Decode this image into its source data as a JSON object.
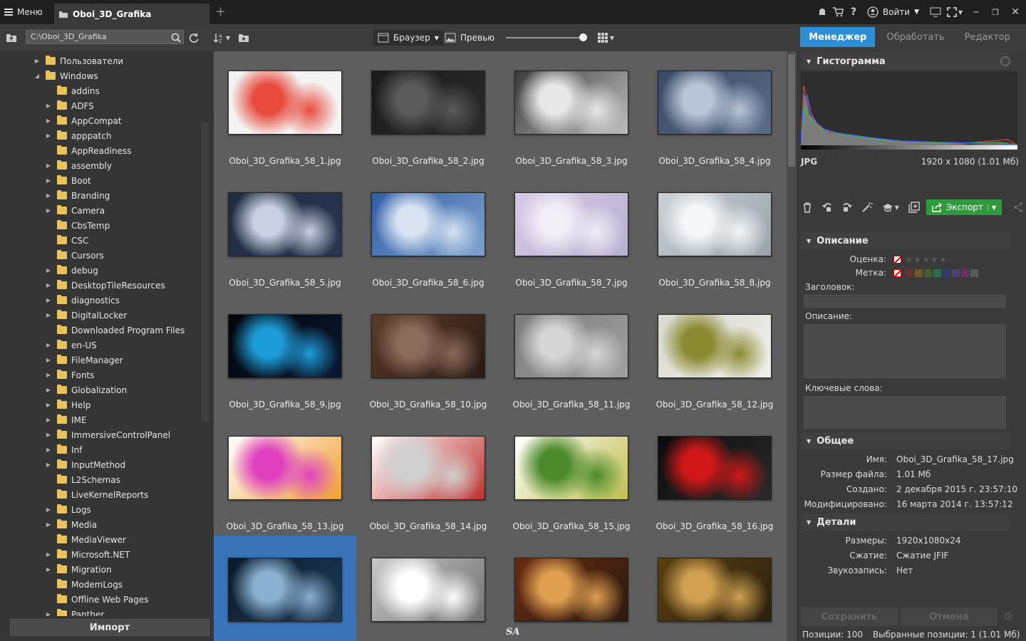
{
  "topbar": {
    "menu_label": "Меню",
    "tab_title": "Oboi_3D_Grafika",
    "signin_label": "Войти"
  },
  "toolbar": {
    "path": "C:\\Oboi_3D_Grafika",
    "view_browser": "Браузер",
    "view_preview": "Превью",
    "zoom_level": 100,
    "modes": [
      "Менеджер",
      "Обработать",
      "Редактор"
    ],
    "active_mode": "Менеджер"
  },
  "tree": {
    "items": [
      {
        "label": "Пользователи",
        "depth": 0,
        "arrow": "collapsed"
      },
      {
        "label": "Windows",
        "depth": 0,
        "arrow": "expanded"
      },
      {
        "label": "addins",
        "depth": 1,
        "arrow": "none"
      },
      {
        "label": "ADFS",
        "depth": 1,
        "arrow": "collapsed"
      },
      {
        "label": "AppCompat",
        "depth": 1,
        "arrow": "collapsed"
      },
      {
        "label": "apppatch",
        "depth": 1,
        "arrow": "collapsed"
      },
      {
        "label": "AppReadiness",
        "depth": 1,
        "arrow": "none"
      },
      {
        "label": "assembly",
        "depth": 1,
        "arrow": "collapsed"
      },
      {
        "label": "Boot",
        "depth": 1,
        "arrow": "collapsed"
      },
      {
        "label": "Branding",
        "depth": 1,
        "arrow": "collapsed"
      },
      {
        "label": "Camera",
        "depth": 1,
        "arrow": "collapsed"
      },
      {
        "label": "CbsTemp",
        "depth": 1,
        "arrow": "none"
      },
      {
        "label": "CSC",
        "depth": 1,
        "arrow": "none"
      },
      {
        "label": "Cursors",
        "depth": 1,
        "arrow": "none"
      },
      {
        "label": "debug",
        "depth": 1,
        "arrow": "collapsed"
      },
      {
        "label": "DesktopTileResources",
        "depth": 1,
        "arrow": "collapsed"
      },
      {
        "label": "diagnostics",
        "depth": 1,
        "arrow": "collapsed"
      },
      {
        "label": "DigitalLocker",
        "depth": 1,
        "arrow": "collapsed"
      },
      {
        "label": "Downloaded Program Files",
        "depth": 1,
        "arrow": "none"
      },
      {
        "label": "en-US",
        "depth": 1,
        "arrow": "collapsed"
      },
      {
        "label": "FileManager",
        "depth": 1,
        "arrow": "collapsed"
      },
      {
        "label": "Fonts",
        "depth": 1,
        "arrow": "collapsed"
      },
      {
        "label": "Globalization",
        "depth": 1,
        "arrow": "collapsed"
      },
      {
        "label": "Help",
        "depth": 1,
        "arrow": "collapsed"
      },
      {
        "label": "IME",
        "depth": 1,
        "arrow": "collapsed"
      },
      {
        "label": "ImmersiveControlPanel",
        "depth": 1,
        "arrow": "collapsed"
      },
      {
        "label": "Inf",
        "depth": 1,
        "arrow": "collapsed"
      },
      {
        "label": "InputMethod",
        "depth": 1,
        "arrow": "collapsed"
      },
      {
        "label": "L2Schemas",
        "depth": 1,
        "arrow": "none"
      },
      {
        "label": "LiveKernelReports",
        "depth": 1,
        "arrow": "none"
      },
      {
        "label": "Logs",
        "depth": 1,
        "arrow": "collapsed"
      },
      {
        "label": "Media",
        "depth": 1,
        "arrow": "collapsed"
      },
      {
        "label": "MediaViewer",
        "depth": 1,
        "arrow": "none"
      },
      {
        "label": "Microsoft.NET",
        "depth": 1,
        "arrow": "collapsed"
      },
      {
        "label": "Migration",
        "depth": 1,
        "arrow": "collapsed"
      },
      {
        "label": "ModemLogs",
        "depth": 1,
        "arrow": "none"
      },
      {
        "label": "Offline Web Pages",
        "depth": 1,
        "arrow": "none"
      },
      {
        "label": "Panther",
        "depth": 1,
        "arrow": "collapsed"
      }
    ],
    "import_label": "Импорт"
  },
  "grid": {
    "selected_index": 16,
    "items": [
      {
        "name": "Oboi_3D_Grafika_58_1.jpg",
        "colors": [
          "#f2f2f2",
          "#e84a3c",
          "#f5f5f5"
        ]
      },
      {
        "name": "Oboi_3D_Grafika_58_2.jpg",
        "colors": [
          "#1a1a1a",
          "#5a5a5a",
          "#2a2a2a"
        ]
      },
      {
        "name": "Oboi_3D_Grafika_58_3.jpg",
        "colors": [
          "#3a3a3a",
          "#e8e8e8",
          "#bdbdbd"
        ]
      },
      {
        "name": "Oboi_3D_Grafika_58_4.jpg",
        "colors": [
          "#3a4a66",
          "#b9c6d8",
          "#5a6b85"
        ]
      },
      {
        "name": "Oboi_3D_Grafika_58_5.jpg",
        "colors": [
          "#1e2b40",
          "#c8d3e2",
          "#2a3650"
        ]
      },
      {
        "name": "Oboi_3D_Grafika_58_6.jpg",
        "colors": [
          "#2f5da6",
          "#d8e4f2",
          "#7fa2cf"
        ]
      },
      {
        "name": "Oboi_3D_Grafika_58_7.jpg",
        "colors": [
          "#d7c9e6",
          "#f2eef7",
          "#b8b0d0"
        ]
      },
      {
        "name": "Oboi_3D_Grafika_58_8.jpg",
        "colors": [
          "#c9d0d6",
          "#f5f7f8",
          "#9aa3ab"
        ]
      },
      {
        "name": "Oboi_3D_Grafika_58_9.jpg",
        "colors": [
          "#02050a",
          "#1e9cd9",
          "#0a1830"
        ]
      },
      {
        "name": "Oboi_3D_Grafika_58_10.jpg",
        "colors": [
          "#5a3a2a",
          "#8a6a5a",
          "#2a1a14"
        ]
      },
      {
        "name": "Oboi_3D_Grafika_58_11.jpg",
        "colors": [
          "#7a7a7a",
          "#d6d6d6",
          "#a0a0a0"
        ]
      },
      {
        "name": "Oboi_3D_Grafika_58_12.jpg",
        "colors": [
          "#d8d8d0",
          "#8a8a30",
          "#f0f0ea"
        ]
      },
      {
        "name": "Oboi_3D_Grafika_58_13.jpg",
        "colors": [
          "#ffffff",
          "#e040c0",
          "#f0a030"
        ]
      },
      {
        "name": "Oboi_3D_Grafika_58_14.jpg",
        "colors": [
          "#ffffff",
          "#d0d0d0",
          "#c03030"
        ]
      },
      {
        "name": "Oboi_3D_Grafika_58_15.jpg",
        "colors": [
          "#ffffff",
          "#4a8a2a",
          "#c0c050"
        ]
      },
      {
        "name": "Oboi_3D_Grafika_58_16.jpg",
        "colors": [
          "#0a0a0a",
          "#d01818",
          "#2a2a2a"
        ]
      },
      {
        "name": "",
        "colors": [
          "#0a1a2a",
          "#8ab0d0",
          "#1e3a55"
        ]
      },
      {
        "name": "",
        "colors": [
          "#c8c8c8",
          "#ffffff",
          "#707070"
        ]
      },
      {
        "name": "",
        "colors": [
          "#6a2a10",
          "#e0a050",
          "#2a1a10"
        ]
      },
      {
        "name": "",
        "colors": [
          "#5a4010",
          "#d0a050",
          "#2a2010"
        ]
      }
    ],
    "watermark": "SA"
  },
  "panel": {
    "histogram_title": "Гистограмма",
    "format": "JPG",
    "resolution": "1920 x 1080 (1.01 Мб)",
    "export_label": "Экспорт",
    "description_title": "Описание",
    "rating_label": "Оценка:",
    "tag_label": "Метка:",
    "headline_label": "Заголовок:",
    "description_label": "Описание:",
    "keywords_label": "Ключевые слова:",
    "general_title": "Общее",
    "details_title": "Детали",
    "general": [
      {
        "label": "Имя:",
        "value": "Oboi_3D_Grafika_58_17.jpg"
      },
      {
        "label": "Размер файла:",
        "value": "1.01 Мб"
      },
      {
        "label": "Создано:",
        "value": "2 декабря 2015 г. 23:57:10"
      },
      {
        "label": "Модифицировано:",
        "value": "16 марта 2014 г. 13:57:12"
      }
    ],
    "details": [
      {
        "label": "Размеры:",
        "value": "1920x1080x24"
      },
      {
        "label": "Сжатие:",
        "value": "Сжатие JFIF"
      },
      {
        "label": "Звукозапись:",
        "value": "Нет"
      }
    ],
    "save_label": "Сохранить",
    "cancel_label": "Отмена",
    "tag_colors": [
      "#6a3030",
      "#6a5a30",
      "#4a5a30",
      "#306a50",
      "#30406a",
      "#504070",
      "#6a3060",
      "#5a5a5a",
      "#3a3a3a"
    ]
  },
  "status": {
    "positions": "Позиции: 100",
    "selected": "Выбранные позиции: 1 (1.01 Мб)"
  }
}
